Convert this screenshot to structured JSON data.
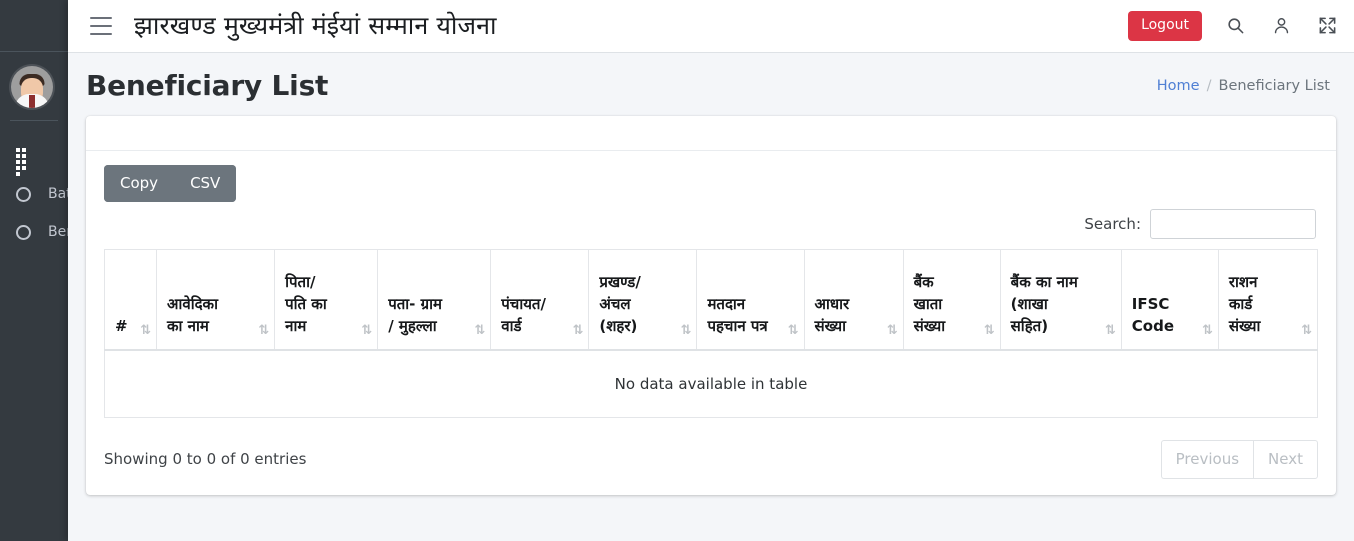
{
  "sidebar": {
    "avatar_name": "user-avatar",
    "items": [
      {
        "id": "dashboard",
        "label": "",
        "icon": "grid-icon"
      },
      {
        "id": "batch",
        "label": "Bat",
        "icon": "circle-icon"
      },
      {
        "id": "beneficiary",
        "label": "Ben",
        "icon": "circle-icon"
      }
    ]
  },
  "navbar": {
    "menu_icon": "hamburger-icon",
    "title": "झारखण्ड मुख्यमंत्री मंईयां सम्मान योजना",
    "logout_label": "Logout",
    "icons": [
      "search-icon",
      "user-icon",
      "fullscreen-icon"
    ],
    "logout_color": "#dc3545"
  },
  "content_header": {
    "page_title": "Beneficiary List",
    "breadcrumb": {
      "home_label": "Home",
      "separator": "/",
      "current_label": "Beneficiary List",
      "link_color": "#4f7fd4"
    }
  },
  "datatable": {
    "buttons": [
      {
        "id": "copy",
        "label": "Copy"
      },
      {
        "id": "csv",
        "label": "CSV"
      }
    ],
    "search": {
      "label": "Search:",
      "value": "",
      "placeholder": ""
    },
    "columns": [
      {
        "id": "index",
        "label": "#",
        "sort": "⇅"
      },
      {
        "id": "applicant",
        "label": "आवेदिका\nका नाम",
        "sort": "⇅"
      },
      {
        "id": "father",
        "label": "पिता/\nपति का\nनाम",
        "sort": "⇅"
      },
      {
        "id": "address",
        "label": "पता- ग्राम\n/ मुहल्ला",
        "sort": "⇅"
      },
      {
        "id": "panchayat",
        "label": "पंचायत/\nवार्ड",
        "sort": "⇅"
      },
      {
        "id": "block",
        "label": "प्रखण्ड/\nअंचल\n(शहर)",
        "sort": "⇅"
      },
      {
        "id": "voter_id",
        "label": "मतदान\nपहचान पत्र",
        "sort": "⇅"
      },
      {
        "id": "aadhaar",
        "label": "आधार\nसंख्या",
        "sort": "⇅"
      },
      {
        "id": "account_no",
        "label": "बैंक\nखाता\nसंख्या",
        "sort": "⇅"
      },
      {
        "id": "bank_name",
        "label": "बैंक का नाम\n(शाखा\nसहित)",
        "sort": "⇅"
      },
      {
        "id": "ifsc",
        "label": "IFSC\nCode",
        "sort": "⇅"
      },
      {
        "id": "ration_card",
        "label": "राशन\nकार्ड\nसंख्या",
        "sort": "⇅"
      }
    ],
    "rows": [],
    "empty_message": "No data available in table",
    "info": "Showing 0 to 0 of 0 entries",
    "pagination": {
      "previous_label": "Previous",
      "next_label": "Next"
    }
  }
}
